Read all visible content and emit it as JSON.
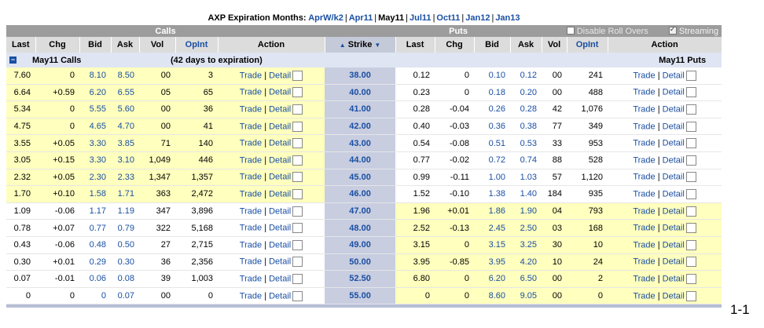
{
  "header": {
    "label": "AXP Expiration Months:",
    "months": [
      {
        "label": "AprW/k2",
        "current": false
      },
      {
        "label": "Apr11",
        "current": false
      },
      {
        "label": "May11",
        "current": true
      },
      {
        "label": "Jul11",
        "current": false
      },
      {
        "label": "Oct11",
        "current": false
      },
      {
        "label": "Jan12",
        "current": false
      },
      {
        "label": "Jan13",
        "current": false
      }
    ]
  },
  "groups": {
    "calls": "Calls",
    "puts": "Puts",
    "disable_rollovers": "Disable Roll Overs",
    "streaming": "Streaming",
    "streaming_checked": true,
    "disable_checked": false
  },
  "columns": {
    "calls": [
      "Last",
      "Chg",
      "Bid",
      "Ask",
      "Vol",
      "OpInt",
      "Action"
    ],
    "strike": "Strike",
    "puts": [
      "Last",
      "Chg",
      "Bid",
      "Ask",
      "Vol",
      "OpInt",
      "Action"
    ]
  },
  "subheader": {
    "calls": "May11 Calls",
    "days": "(42 days to expiration)",
    "puts": "May11 Puts"
  },
  "actions": {
    "trade": "Trade",
    "detail": "Detail",
    "sep": "|"
  },
  "rows": [
    {
      "strike": "38.00",
      "itm_calls": true,
      "call": [
        "7.60",
        "0",
        "8.10",
        "8.50",
        "00",
        "3"
      ],
      "put": [
        "0.12",
        "0",
        "0.10",
        "0.12",
        "00",
        "241"
      ]
    },
    {
      "strike": "40.00",
      "itm_calls": true,
      "call": [
        "6.64",
        "+0.59",
        "6.20",
        "6.55",
        "05",
        "65"
      ],
      "put": [
        "0.23",
        "0",
        "0.18",
        "0.20",
        "00",
        "488"
      ]
    },
    {
      "strike": "41.00",
      "itm_calls": true,
      "call": [
        "5.34",
        "0",
        "5.55",
        "5.60",
        "00",
        "36"
      ],
      "put": [
        "0.28",
        "-0.04",
        "0.26",
        "0.28",
        "42",
        "1,076"
      ]
    },
    {
      "strike": "42.00",
      "itm_calls": true,
      "call": [
        "4.75",
        "0",
        "4.65",
        "4.70",
        "00",
        "41"
      ],
      "put": [
        "0.40",
        "-0.03",
        "0.36",
        "0.38",
        "77",
        "349"
      ]
    },
    {
      "strike": "43.00",
      "itm_calls": true,
      "call": [
        "3.55",
        "+0.05",
        "3.30",
        "3.85",
        "71",
        "140"
      ],
      "put": [
        "0.54",
        "-0.08",
        "0.51",
        "0.53",
        "33",
        "953"
      ]
    },
    {
      "strike": "44.00",
      "itm_calls": true,
      "call": [
        "3.05",
        "+0.15",
        "3.30",
        "3.10",
        "1,049",
        "446"
      ],
      "put": [
        "0.77",
        "-0.02",
        "0.72",
        "0.74",
        "88",
        "528"
      ]
    },
    {
      "strike": "45.00",
      "itm_calls": true,
      "call": [
        "2.32",
        "+0.05",
        "2.30",
        "2.33",
        "1,347",
        "1,357"
      ],
      "put": [
        "0.99",
        "-0.11",
        "1.00",
        "1.03",
        "57",
        "1,120"
      ]
    },
    {
      "strike": "46.00",
      "itm_calls": true,
      "call": [
        "1.70",
        "+0.10",
        "1.58",
        "1.71",
        "363",
        "2,472"
      ],
      "put": [
        "1.52",
        "-0.10",
        "1.38",
        "1.40",
        "184",
        "935"
      ]
    },
    {
      "strike": "47.00",
      "itm_calls": false,
      "call": [
        "1.09",
        "-0.06",
        "1.17",
        "1.19",
        "347",
        "3,896"
      ],
      "put": [
        "1.96",
        "+0.01",
        "1.86",
        "1.90",
        "04",
        "793"
      ]
    },
    {
      "strike": "48.00",
      "itm_calls": false,
      "call": [
        "0.78",
        "+0.07",
        "0.77",
        "0.79",
        "322",
        "5,168"
      ],
      "put": [
        "2.52",
        "-0.13",
        "2.45",
        "2.50",
        "03",
        "168"
      ]
    },
    {
      "strike": "49.00",
      "itm_calls": false,
      "call": [
        "0.43",
        "-0.06",
        "0.48",
        "0.50",
        "27",
        "2,715"
      ],
      "put": [
        "3.15",
        "0",
        "3.15",
        "3.25",
        "30",
        "10"
      ]
    },
    {
      "strike": "50.00",
      "itm_calls": false,
      "call": [
        "0.30",
        "+0.01",
        "0.29",
        "0.30",
        "36",
        "2,356"
      ],
      "put": [
        "3.95",
        "-0.85",
        "3.95",
        "4.20",
        "10",
        "24"
      ]
    },
    {
      "strike": "52.50",
      "itm_calls": false,
      "call": [
        "0.07",
        "-0.01",
        "0.06",
        "0.08",
        "39",
        "1,003"
      ],
      "put": [
        "6.80",
        "0",
        "6.20",
        "6.50",
        "00",
        "2"
      ]
    },
    {
      "strike": "55.00",
      "itm_calls": false,
      "call": [
        "0",
        "0",
        "0",
        "0.07",
        "00",
        "0"
      ],
      "put": [
        "0",
        "0",
        "8.60",
        "9.05",
        "00",
        "0"
      ]
    }
  ],
  "page_number": "1-1",
  "colors": {
    "itm_highlight": "#ffffbe",
    "header_gray": "#9c9c9c",
    "link_blue": "#1a4fa3",
    "strike_bg": "#c8cde0"
  }
}
